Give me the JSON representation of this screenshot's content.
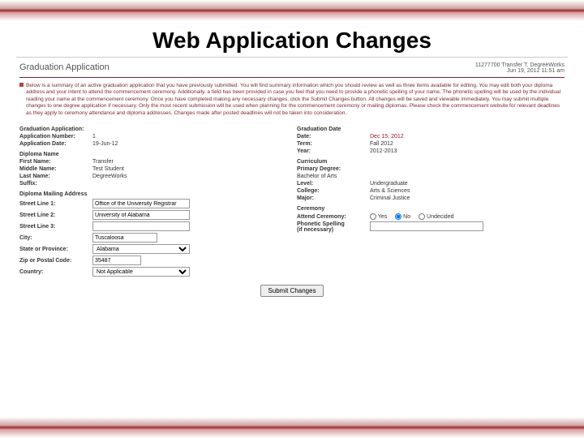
{
  "slide": {
    "title": "Web Application Changes"
  },
  "header": {
    "app_title": "Graduation Application",
    "user_line": "11277700  Transfer T. DegreeWorks",
    "timestamp": "Jun 19, 2012 11:51 am"
  },
  "info_text": "Below is a summary of an active graduation application that you have previously submitted. You will find summary information which you should review as well as three items available for editing. You may edit both your diploma address and your intent to attend the commencement ceremony. Additionally, a field has been provided in case you feel that you need to provide a phonetic spelling of your name. The phonetic spelling will be used by the individual reading your name at the commencement ceremony. Once you have completed making any necessary changes, click the Submit Changes button. All changes will be saved and viewable immediately. You may submit multiple changes to one degree application if necessary. Only the most recent submission will be used when planning for the commencement ceremony or mailing diplomas. Please check the commencement website for relevant deadlines as they apply to ceremony attendance and diploma addresses. Changes made after posted deadlines will not be taken into consideration.",
  "sections": {
    "grad_app": {
      "head": "Graduation Application:",
      "app_num_label": "Application Number:",
      "app_num": "1",
      "app_date_label": "Application Date:",
      "app_date": "19-Jun-12"
    },
    "grad_date": {
      "head": "Graduation Date",
      "date_label": "Date:",
      "date": "Dec 15, 2012",
      "term_label": "Term:",
      "term": "Fall 2012",
      "year_label": "Year:",
      "year": "2012-2013"
    },
    "diploma_name": {
      "head": "Diploma Name",
      "first_label": "First Name:",
      "first": "Transfer",
      "middle_label": "Middle Name:",
      "middle": "Test Student",
      "last_label": "Last Name:",
      "last": "DegreeWorks",
      "suffix_label": "Suffix:",
      "suffix": ""
    },
    "curriculum": {
      "head": "Curriculum",
      "degree_label": "Primary Degree:",
      "degree": "Bachelor of Arts",
      "level_label": "Level:",
      "level": "Undergraduate",
      "college_label": "College:",
      "college": "Arts & Sciences",
      "major_label": "Major:",
      "major": "Criminal Justice"
    },
    "mailing": {
      "head": "Diploma Mailing Address",
      "line1_label": "Street Line 1:",
      "line1": "Office of the University Registrar",
      "line2_label": "Street Line 2:",
      "line2": "University of Alabama",
      "line3_label": "Street Line 3:",
      "line3": "",
      "city_label": "City:",
      "city": "Tuscaloosa",
      "state_label": "State or Province:",
      "state": "Alabama",
      "zip_label": "Zip or Postal Code:",
      "zip": "35487",
      "country_label": "Country:",
      "country": "Not Applicable"
    },
    "ceremony": {
      "head": "Ceremony",
      "attend_label": "Attend Ceremony:",
      "opt_yes": "Yes",
      "opt_no": "No",
      "opt_und": "Undecided",
      "phonetic_label1": "Phonetic Spelling",
      "phonetic_label2": "(if necessary)",
      "phonetic": ""
    }
  },
  "submit_label": "Submit Changes"
}
